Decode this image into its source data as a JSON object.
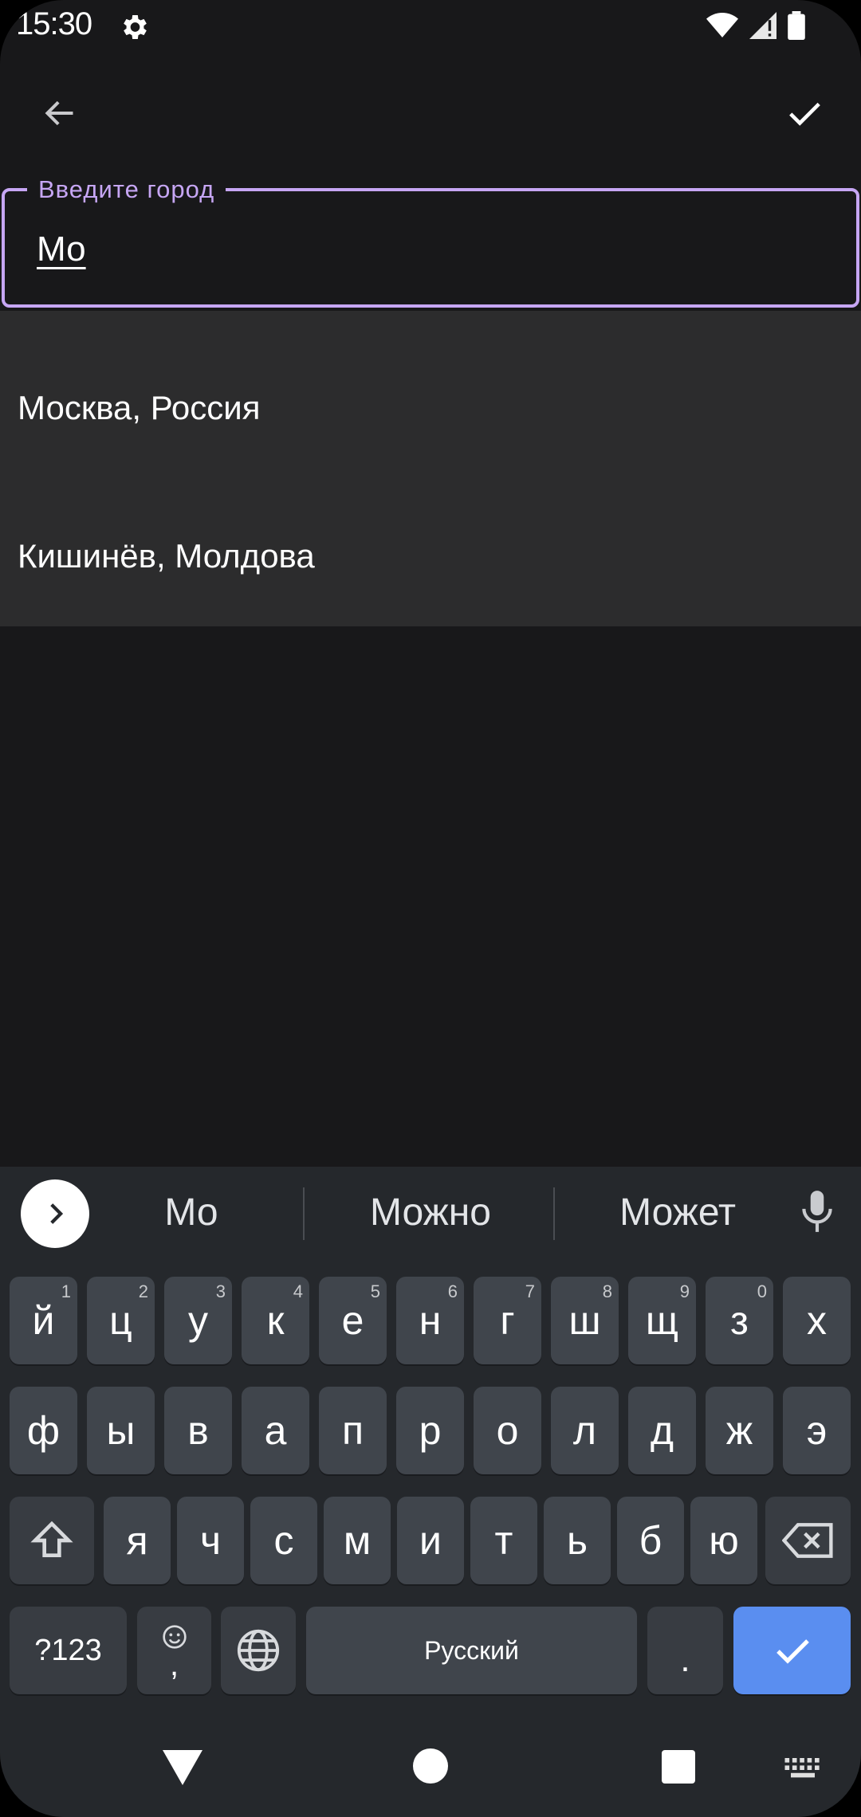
{
  "status": {
    "time": "15:30"
  },
  "field": {
    "label": "Введите город",
    "value": "Мо"
  },
  "suggestions": [
    {
      "label": "Москва, Россия"
    },
    {
      "label": "Кишинёв, Молдова"
    }
  ],
  "keyboard": {
    "word_suggestions": [
      "Мо",
      "Можно",
      "Может"
    ],
    "row1": [
      {
        "label": "й",
        "hint": "1"
      },
      {
        "label": "ц",
        "hint": "2"
      },
      {
        "label": "у",
        "hint": "3"
      },
      {
        "label": "к",
        "hint": "4"
      },
      {
        "label": "е",
        "hint": "5"
      },
      {
        "label": "н",
        "hint": "6"
      },
      {
        "label": "г",
        "hint": "7"
      },
      {
        "label": "ш",
        "hint": "8"
      },
      {
        "label": "щ",
        "hint": "9"
      },
      {
        "label": "з",
        "hint": "0"
      },
      {
        "label": "х",
        "hint": ""
      }
    ],
    "row2": [
      "ф",
      "ы",
      "в",
      "а",
      "п",
      "р",
      "о",
      "л",
      "д",
      "ж",
      "э"
    ],
    "row3": [
      "я",
      "ч",
      "с",
      "м",
      "и",
      "т",
      "ь",
      "б",
      "ю"
    ],
    "symbols_label": "?123",
    "comma_label": ",",
    "space_label": "Русский",
    "period_label": "."
  },
  "accent_color": "#c6a6f4",
  "enter_color": "#5a8ef0"
}
